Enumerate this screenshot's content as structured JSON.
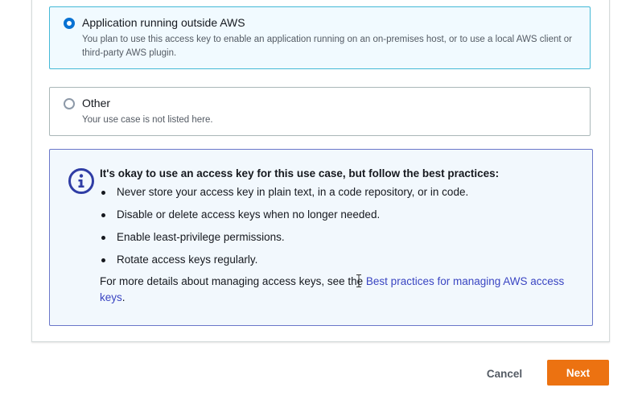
{
  "options": [
    {
      "title": "Application running outside AWS",
      "description": "You plan to use this access key to enable an application running on an on-premises host, or to use a local AWS client or third-party AWS plugin.",
      "selected": true
    },
    {
      "title": "Other",
      "description": "Your use case is not listed here.",
      "selected": false
    }
  ],
  "info": {
    "icon": "info-icon",
    "heading": "It's okay to use an access key for this use case, but follow the best practices:",
    "bullets": [
      "Never store your access key in plain text, in a code repository, or in code.",
      "Disable or delete access keys when no longer needed.",
      "Enable least-privilege permissions.",
      "Rotate access keys regularly."
    ],
    "more_prefix": "For more details about managing access keys, see the ",
    "more_link": "Best practices for managing AWS access keys",
    "more_suffix": "."
  },
  "actions": {
    "cancel_label": "Cancel",
    "next_label": "Next"
  },
  "colors": {
    "selected_border": "#44b9d6",
    "selected_bg": "#f1faff",
    "info_border": "#6a77c9",
    "info_icon": "#2f3da5",
    "link": "#3a45c2",
    "primary_button": "#ec7211"
  }
}
